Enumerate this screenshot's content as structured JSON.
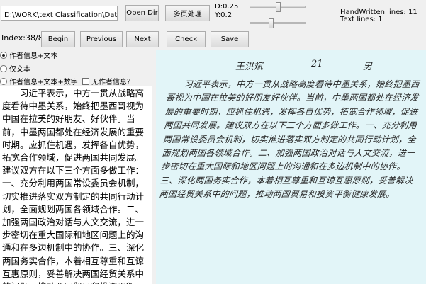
{
  "toolbar": {
    "path": "D:\\WORK\\text Classification\\DataSet\\国际要案-line\\",
    "open_dir_label": "Open Dir",
    "multi_page_label": "多页处理",
    "d_value": "D:0.25",
    "y_value": "Y:0.2",
    "d_slider_level": 0.5,
    "y_slider_level": 0.05,
    "handwritten_lines": "HandWritten lines: 11",
    "text_lines": "Text lines: 1"
  },
  "nav": {
    "index_label": "Index:38/8",
    "begin_label": "Begin",
    "previous_label": "Previous",
    "next_label": "Next",
    "check_label": "Check",
    "save_label": "Save"
  },
  "options": {
    "author_text": "作者信息+文本",
    "text_only": "仅文本",
    "author_text_number": "作者信息+文本+数字",
    "no_author": "无作者信息？",
    "selected": "author_text"
  },
  "text_content": "习近平表示，中方一贯从战略高度看待中墨关系，始终把墨西哥视为中国在拉美的好朋友、好伙伴。当前，中墨两国都处在经济发展的重要时期。应抓住机遇，发挥各自优势，拓宽合作领域，促进两国共同发展。建议双方在以下三个方面多做工作：一、充分利用两国常设委员会机制，切实推进落实双方制定的共同行动计划，全面规划两国各领域合作。二、加强两国政治对话与人文交流，进一步密切在重大国际和地区问题上的沟通和在多边机制中的协作。三、深化两国务实合作，本着相互尊重和互谅互惠原则，妥善解决两国经贸关系中的问题，推动两国贸易和投资平衡、健康发展。",
  "handwriting": {
    "writer_name": "王洪斌",
    "age": "21",
    "gender": "男",
    "body": "习近平表示，中方一贯从战略高度看待中墨关系，始终把墨西哥视为中国在拉美的好朋友好伙伴。当前，中墨两国都处在经济发展的重要时期，应抓住机遇，发挥各自优势，拓宽合作领域，促进两国共同发展。建议双方在以下三个方面多做工作。一、充分利用两国常设委员会机制，切实推进落实双方制定的共同行动计划，全面规划两国各领域合作。二、加强两国政治对话与人文交流，进一步密切在重大国际和地区问题上的沟通和在多边机制中的协作。三、深化两国务实合作，本着相互尊重和互谅互惠原则，妥善解决两国经贸关系中的问题，推动两国贸易和投资平衡健康发展。"
  }
}
